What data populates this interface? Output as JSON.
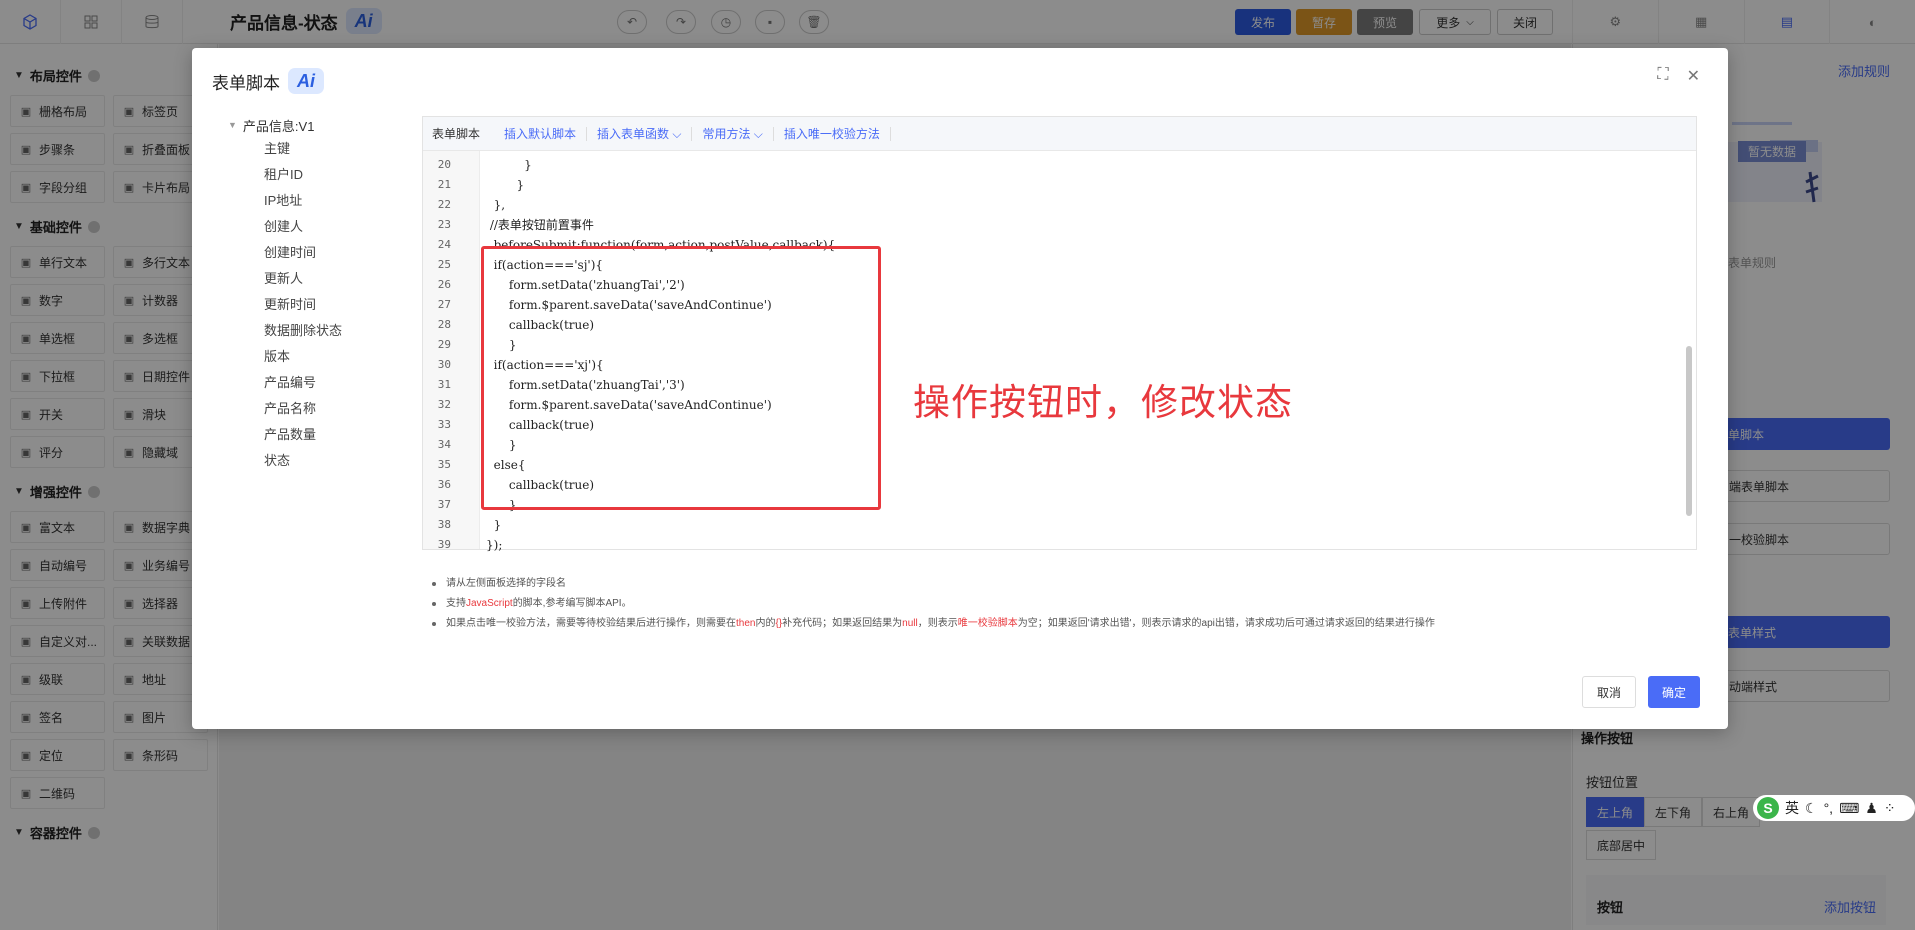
{
  "header": {
    "title": "产品信息-状态",
    "ai_badge": "Ai",
    "buttons": {
      "publish": "发布",
      "draft": "暂存",
      "preview": "预览",
      "more": "更多",
      "close": "关闭"
    },
    "colors": {
      "publish": "#2d5be3",
      "draft": "#e09a29",
      "preview": "#7d7d7d",
      "accent": "#4a6cf7"
    }
  },
  "left_panel": {
    "groups": [
      {
        "title": "布局控件",
        "items": [
          {
            "label": "栅格布局",
            "icon": "grid-icon"
          },
          {
            "label": "标签页",
            "icon": "tab-icon"
          },
          {
            "label": "步骤条",
            "icon": "steps-icon"
          },
          {
            "label": "折叠面板",
            "icon": "collapse-icon"
          },
          {
            "label": "字段分组",
            "icon": "group-icon"
          },
          {
            "label": "卡片布局",
            "icon": "card-icon"
          }
        ]
      },
      {
        "title": "基础控件",
        "items": [
          {
            "label": "单行文本",
            "icon": "input-icon"
          },
          {
            "label": "多行文本",
            "icon": "textarea-icon"
          },
          {
            "label": "数字",
            "icon": "number-icon"
          },
          {
            "label": "计数器",
            "icon": "counter-icon"
          },
          {
            "label": "单选框",
            "icon": "radio-icon"
          },
          {
            "label": "多选框",
            "icon": "checkbox-icon"
          },
          {
            "label": "下拉框",
            "icon": "select-icon"
          },
          {
            "label": "日期控件",
            "icon": "date-icon"
          },
          {
            "label": "开关",
            "icon": "switch-icon"
          },
          {
            "label": "滑块",
            "icon": "slider-icon"
          },
          {
            "label": "评分",
            "icon": "star-icon"
          },
          {
            "label": "隐藏域",
            "icon": "hidden-icon"
          }
        ]
      },
      {
        "title": "增强控件",
        "items": [
          {
            "label": "富文本",
            "icon": "richtext-icon"
          },
          {
            "label": "数据字典",
            "icon": "dict-icon"
          },
          {
            "label": "自动编号",
            "icon": "autonum-icon"
          },
          {
            "label": "业务编号",
            "icon": "biznum-icon"
          },
          {
            "label": "上传附件",
            "icon": "upload-icon"
          },
          {
            "label": "选择器",
            "icon": "selector-icon"
          },
          {
            "label": "自定义对...",
            "icon": "custom-icon"
          },
          {
            "label": "关联数据",
            "icon": "link-icon"
          },
          {
            "label": "级联",
            "icon": "cascade-icon"
          },
          {
            "label": "地址",
            "icon": "address-icon"
          },
          {
            "label": "签名",
            "icon": "sign-icon"
          },
          {
            "label": "图片",
            "icon": "image-icon"
          },
          {
            "label": "定位",
            "icon": "location-icon"
          },
          {
            "label": "条形码",
            "icon": "barcode-icon"
          },
          {
            "label": "二维码",
            "icon": "qrcode-icon"
          }
        ]
      },
      {
        "title": "容器控件",
        "items": []
      }
    ]
  },
  "right_panel": {
    "add_rule": "添加规则",
    "empty_tag": "暂无数据",
    "empty_hint": "表单规则",
    "btn_script": "单脚本",
    "btn_script2": "端表单脚本",
    "btn_check": "一校验脚本",
    "btn_style": "表单样式",
    "btn_style2": "动端样式",
    "op_title": "操作按钮",
    "pos_label": "按钮位置",
    "pos_opts": [
      "左上角",
      "左下角",
      "右上角"
    ],
    "pos_bottom": "底部居中",
    "btn_label": "按钮",
    "add_btn": "添加按钮"
  },
  "modal": {
    "title": "表单脚本",
    "ai_badge": "Ai",
    "tree_root": "产品信息:V1",
    "tree_items": [
      "主键",
      "租户ID",
      "IP地址",
      "创建人",
      "创建时间",
      "更新人",
      "更新时间",
      "数据删除状态",
      "版本",
      "产品编号",
      "产品名称",
      "产品数量",
      "状态"
    ],
    "toolbar": {
      "label": "表单脚本",
      "tools": [
        "插入默认脚本",
        "插入表单函数 ⌵",
        "常用方法 ⌵",
        "插入唯一校验方法"
      ]
    },
    "code_lines": [
      {
        "n": "20",
        "t": "          }"
      },
      {
        "n": "21",
        "t": "        }"
      },
      {
        "n": "22",
        "t": "  },"
      },
      {
        "n": "23",
        "t": " //表单按钮前置事件"
      },
      {
        "n": "24",
        "t": "  beforeSubmit:function(form,action,postValue,callback){"
      },
      {
        "n": "25",
        "t": "  if(action==='sj'){"
      },
      {
        "n": "26",
        "t": "      form.setData('zhuangTai','2')"
      },
      {
        "n": "27",
        "t": "      form.$parent.saveData('saveAndContinue')"
      },
      {
        "n": "28",
        "t": "      callback(true)"
      },
      {
        "n": "29",
        "t": "      }"
      },
      {
        "n": "30",
        "t": "  if(action==='xj'){"
      },
      {
        "n": "31",
        "t": "      form.setData('zhuangTai','3')"
      },
      {
        "n": "32",
        "t": "      form.$parent.saveData('saveAndContinue')"
      },
      {
        "n": "33",
        "t": "      callback(true)"
      },
      {
        "n": "34",
        "t": "      }"
      },
      {
        "n": "35",
        "t": "  else{"
      },
      {
        "n": "36",
        "t": "      callback(true)"
      },
      {
        "n": "37",
        "t": "      }"
      },
      {
        "n": "38",
        "t": "  }"
      },
      {
        "n": "39",
        "t": "});"
      }
    ],
    "annotation": "操作按钮时，修改状态",
    "notes": {
      "n1": "请从左侧面板选择的字段名",
      "n2a": "支持",
      "n2b": "JavaScript",
      "n2c": "的脚本,参考编写脚本API。",
      "n3a": "如果点击唯一校验方法，需要等待校验结果后进行操作，则需要在",
      "n3b": "then",
      "n3c": "内的",
      "n3d": "{}",
      "n3e": "补充代码；如果返回结果为",
      "n3f": "null",
      "n3g": "，则表示",
      "n3h": "唯一校验脚本",
      "n3i": "为空；如果返回'请求出错'，则表示请求的api出错，请求成功后可通过请求返回的结果进行操作"
    },
    "cancel": "取消",
    "ok": "确定"
  },
  "ime": {
    "lang": "英"
  }
}
